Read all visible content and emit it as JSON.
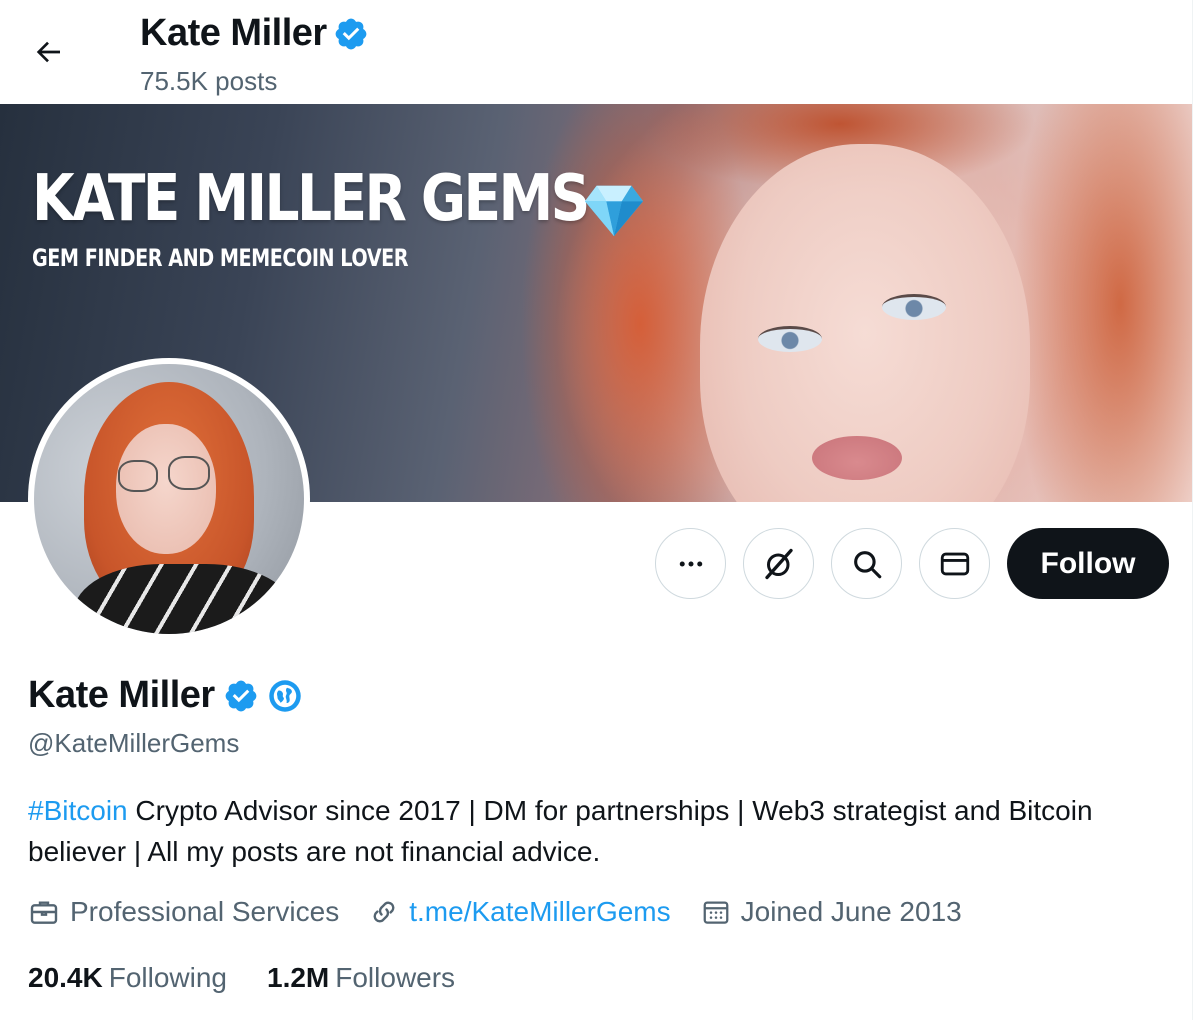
{
  "header": {
    "name": "Kate Miller",
    "posts": "75.5K posts"
  },
  "banner": {
    "title": "KATE MILLER GEMS",
    "subtitle": "GEM FINDER AND MEMECOIN LOVER"
  },
  "actions": {
    "follow_label": "Follow"
  },
  "profile": {
    "display_name": "Kate Miller",
    "handle": "@KateMillerGems",
    "bio_hashtag": "#Bitcoin",
    "bio_text": " Crypto Advisor since 2017 | DM for partnerships | Web3 strategist and Bitcoin believer | All my posts are not financial advice.",
    "category": "Professional Services",
    "link": "t.me/KateMillerGems",
    "joined": "Joined June 2013"
  },
  "stats": {
    "following_count": "20.4K",
    "following_label": "Following",
    "followers_count": "1.2M",
    "followers_label": "Followers"
  },
  "colors": {
    "accent": "#1d9bf0",
    "text": "#0f1419",
    "muted": "#536471",
    "border": "#cfd9de"
  }
}
